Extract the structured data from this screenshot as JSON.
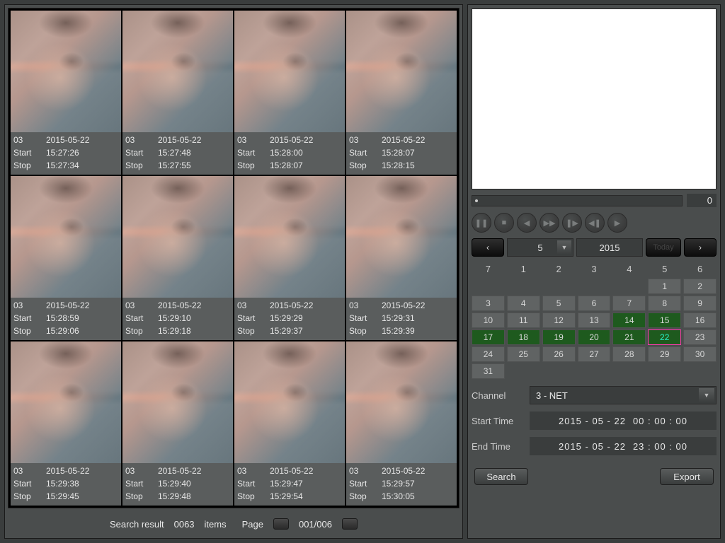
{
  "thumbnails": [
    {
      "ch": "03",
      "date": "2015-05-22",
      "start": "15:27:26",
      "stop": "15:27:34"
    },
    {
      "ch": "03",
      "date": "2015-05-22",
      "start": "15:27:48",
      "stop": "15:27:55"
    },
    {
      "ch": "03",
      "date": "2015-05-22",
      "start": "15:28:00",
      "stop": "15:28:07"
    },
    {
      "ch": "03",
      "date": "2015-05-22",
      "start": "15:28:07",
      "stop": "15:28:15"
    },
    {
      "ch": "03",
      "date": "2015-05-22",
      "start": "15:28:59",
      "stop": "15:29:06"
    },
    {
      "ch": "03",
      "date": "2015-05-22",
      "start": "15:29:10",
      "stop": "15:29:18"
    },
    {
      "ch": "03",
      "date": "2015-05-22",
      "start": "15:29:29",
      "stop": "15:29:37"
    },
    {
      "ch": "03",
      "date": "2015-05-22",
      "start": "15:29:31",
      "stop": "15:29:39"
    },
    {
      "ch": "03",
      "date": "2015-05-22",
      "start": "15:29:38",
      "stop": "15:29:45"
    },
    {
      "ch": "03",
      "date": "2015-05-22",
      "start": "15:29:40",
      "stop": "15:29:48"
    },
    {
      "ch": "03",
      "date": "2015-05-22",
      "start": "15:29:47",
      "stop": "15:29:54"
    },
    {
      "ch": "03",
      "date": "2015-05-22",
      "start": "15:29:57",
      "stop": "15:30:05"
    }
  ],
  "meta_labels": {
    "start": "Start",
    "stop": "Stop"
  },
  "searchbar": {
    "result_label": "Search result",
    "count": "0063",
    "items_label": "items",
    "page_label": "Page",
    "page_value": "001/006"
  },
  "slider": {
    "value": "0"
  },
  "play_icons": [
    "❚❚",
    "■",
    "◀",
    "▶▶",
    "❚▶",
    "◀❚",
    "▶"
  ],
  "month_nav": {
    "month": "5",
    "year": "2015",
    "today_label": "Today"
  },
  "calendar": {
    "weekdays": [
      "7",
      "1",
      "2",
      "3",
      "4",
      "5",
      "6"
    ],
    "days": [
      "",
      "",
      "",
      "",
      "",
      "1",
      "2",
      "3",
      "4",
      "5",
      "6",
      "7",
      "8",
      "9",
      "10",
      "11",
      "12",
      "13",
      "14",
      "15",
      "16",
      "17",
      "18",
      "19",
      "20",
      "21",
      "22",
      "23",
      "24",
      "25",
      "26",
      "27",
      "28",
      "29",
      "30",
      "31",
      "",
      "",
      "",
      "",
      "",
      ""
    ],
    "green": [
      "14",
      "15",
      "17",
      "18",
      "19",
      "20",
      "21",
      "22"
    ],
    "selected": "22"
  },
  "form": {
    "channel_label": "Channel",
    "channel_value": "3 - NET",
    "start_label": "Start Time",
    "start_date": "2015  -  05  -  22",
    "start_time": "00  :  00  :  00",
    "end_label": "End Time",
    "end_date": "2015  -  05  -  22",
    "end_time": "23  :  00  :  00"
  },
  "buttons": {
    "search": "Search",
    "export": "Export"
  }
}
